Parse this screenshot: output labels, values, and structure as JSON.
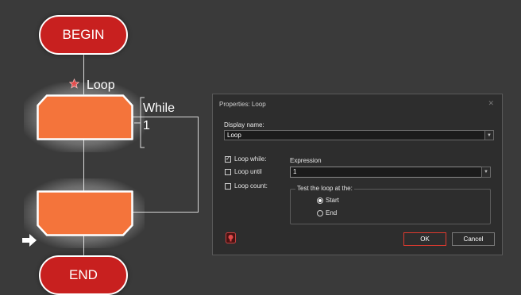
{
  "flowchart": {
    "begin_label": "BEGIN",
    "loop_label": "Loop",
    "while_label": "While",
    "condition_label": "1",
    "end_label": "END",
    "colors": {
      "terminal": "#c8201f",
      "block": "#f4743b",
      "star": "#e03a3a"
    }
  },
  "dialog": {
    "title": "Properties: Loop",
    "close_icon": "close-icon",
    "display_name_label": "Display name:",
    "display_name_value": "Loop",
    "loop_while_label": "Loop while:",
    "loop_while_checked": true,
    "loop_until_label": "Loop until",
    "loop_count_label": "Loop count:",
    "expression_label": "Expression",
    "expression_value": "1",
    "test_group_label": "Test the loop at the:",
    "start_label": "Start",
    "end_label": "End",
    "ok_label": "OK",
    "cancel_label": "Cancel",
    "accent": "#e03a2f"
  }
}
